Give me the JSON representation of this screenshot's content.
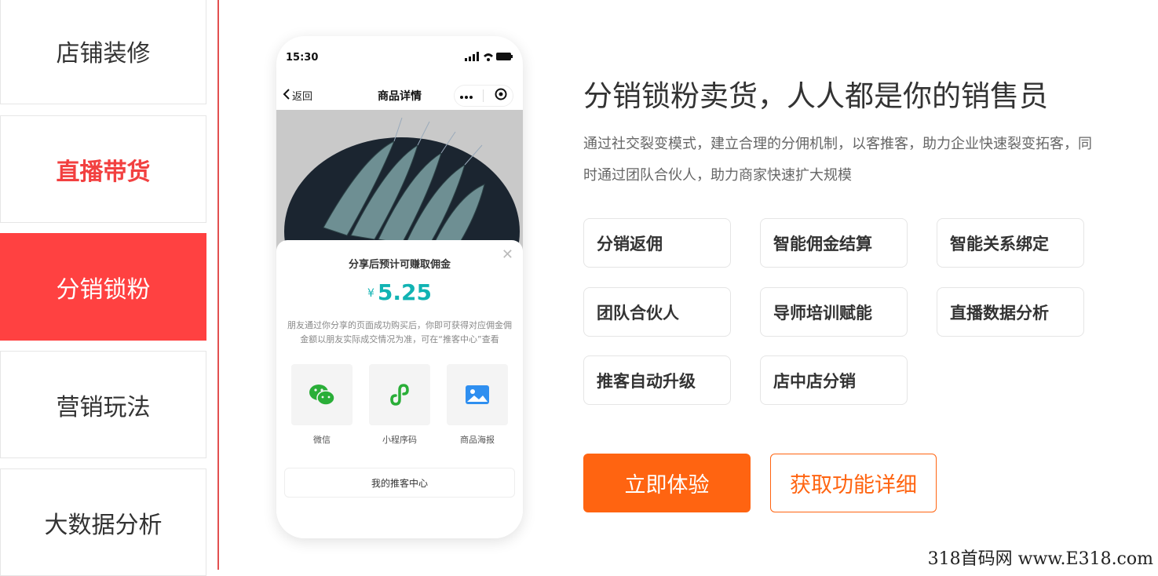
{
  "sidebar": {
    "items": [
      {
        "label": "店铺装修"
      },
      {
        "label": "直播带货"
      },
      {
        "label": "分销锁粉"
      },
      {
        "label": "营销玩法"
      },
      {
        "label": "大数据分析"
      }
    ],
    "active_index": 2
  },
  "phone": {
    "status_time": "15:30",
    "back_label": "返回",
    "nav_title": "商品详情",
    "share": {
      "title": "分享后预计可赚取佣金",
      "currency": "¥",
      "amount": "5.25",
      "description": "朋友通过你分享的页面成功购买后，你即可获得对应佣金佣金额以朋友实际成交情况为准，可在“推客中心”查看",
      "options": [
        {
          "label": "微信",
          "icon": "wechat-icon"
        },
        {
          "label": "小程序码",
          "icon": "mini-program-icon"
        },
        {
          "label": "商品海报",
          "icon": "image-icon"
        }
      ],
      "my_center_label": "我的推客中心"
    }
  },
  "content": {
    "headline": "分销锁粉卖货，人人都是你的销售员",
    "description": "通过社交裂变模式，建立合理的分佣机制，以客推客，助力企业快速裂变拓客，同时通过团队合伙人，助力商家快速扩大规模",
    "features": [
      "分销返佣",
      "智能佣金结算",
      "智能关系绑定",
      "团队合伙人",
      "导师培训赋能",
      "直播数据分析",
      "推客自动升级",
      "店中店分销"
    ],
    "primary_button": "立即体验",
    "secondary_button": "获取功能详细"
  },
  "watermark": "318首码网 www.E318.com",
  "colors": {
    "accent_red": "#ff4141",
    "accent_orange": "#ff6411",
    "commission_teal": "#11b3b3"
  }
}
